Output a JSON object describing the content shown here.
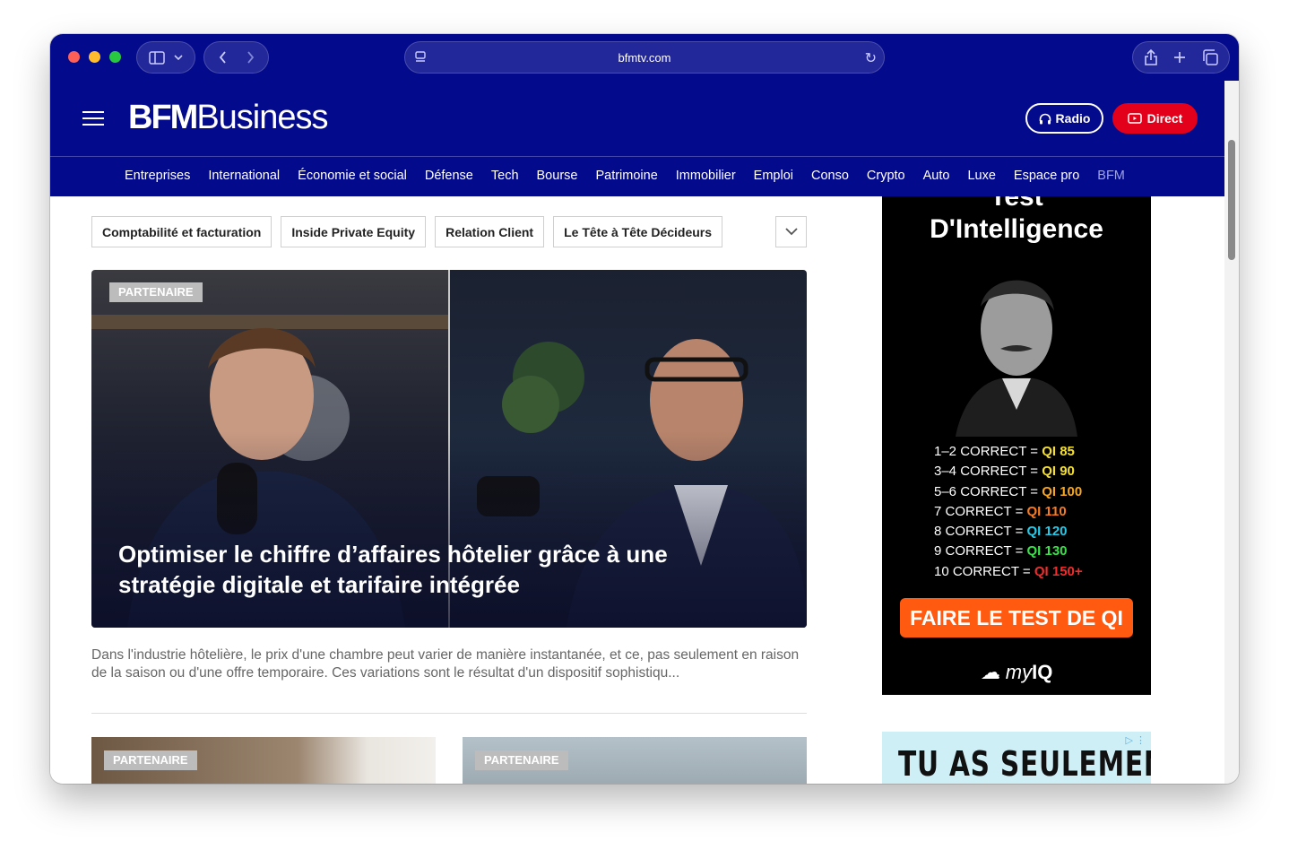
{
  "browser": {
    "url": "bfmtv.com"
  },
  "header": {
    "logo_bold": "BFM",
    "logo_light": "Business",
    "radio_label": "Radio",
    "direct_label": "Direct"
  },
  "nav": {
    "items": [
      "Entreprises",
      "International",
      "Économie et social",
      "Défense",
      "Tech",
      "Bourse",
      "Patrimoine",
      "Immobilier",
      "Emploi",
      "Conso",
      "Crypto",
      "Auto",
      "Luxe",
      "Espace pro",
      "BFM"
    ]
  },
  "tags": [
    "Comptabilité et facturation",
    "Inside Private Equity",
    "Relation Client",
    "Le Tête à Tête Décideurs"
  ],
  "hero": {
    "badge": "PARTENAIRE",
    "title": "Optimiser le chiffre d’affaires hôtelier grâce à une stratégie digitale et tarifaire intégrée",
    "excerpt": "Dans l'industrie hôtelière, le prix d'une chambre peut varier de manière instantanée, et ce, pas seulement en raison de la saison ou d'une offre temporaire. Ces variations sont le résultat d'un dispositif sophistiqu..."
  },
  "cards": [
    {
      "badge": "PARTENAIRE"
    },
    {
      "badge": "PARTENAIRE"
    }
  ],
  "ad_iq": {
    "title_line1": "Test",
    "title_line2": "D'Intelligence",
    "rows": [
      {
        "label": "1–2 CORRECT = ",
        "score": "QI 85",
        "color": "#f5e030"
      },
      {
        "label": "3–4 CORRECT = ",
        "score": "QI 90",
        "color": "#f5e030"
      },
      {
        "label": "5–6 CORRECT = ",
        "score": "QI 100",
        "color": "#f5a623"
      },
      {
        "label": "7 CORRECT = ",
        "score": "QI 110",
        "color": "#f57a23"
      },
      {
        "label": "8 CORRECT = ",
        "score": "QI 120",
        "color": "#27c9e8"
      },
      {
        "label": "9 CORRECT = ",
        "score": "QI 130",
        "color": "#3be04a"
      },
      {
        "label": "10 CORRECT = ",
        "score": "QI 150+",
        "color": "#f02d2d"
      }
    ],
    "cta": "FAIRE LE TEST DE QI",
    "brand_my": "my",
    "brand_iq": "IQ"
  },
  "ad_second": {
    "text": "TU AS SEULEMENT"
  },
  "colors": {
    "brand_blue": "#040a8c",
    "direct_red": "#e2001a",
    "cta_orange": "#ff5a10"
  }
}
